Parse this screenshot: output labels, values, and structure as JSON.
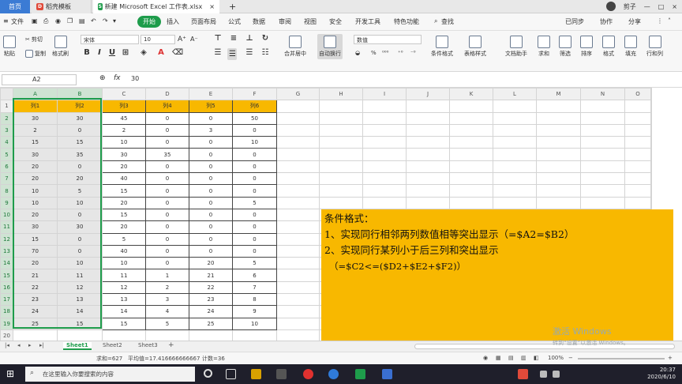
{
  "tabs": {
    "home": "首页",
    "t1": "稻壳模板",
    "t2": "新建 Microsoft Excel 工作表.xlsx",
    "add": "+"
  },
  "titlebar": {
    "user": "剪子"
  },
  "menu": [
    "文件",
    "开始",
    "插入",
    "页面布局",
    "公式",
    "数据",
    "审阅",
    "视图",
    "安全",
    "开发工具",
    "特色功能",
    "查找"
  ],
  "menu_right": [
    "已同步",
    "协作",
    "分享"
  ],
  "ribbon": {
    "paste": "粘贴",
    "cut": "剪切",
    "copy": "复制",
    "painter": "格式刷",
    "font": "宋体",
    "size": "10",
    "merge": "合并居中",
    "wrap": "自动换行",
    "numfmt": "数值",
    "cond": "条件格式",
    "tablestyle": "表格样式",
    "docassist": "文档助手",
    "sum": "求和",
    "filter": "筛选",
    "sort": "排序",
    "format": "格式",
    "fill": "填充",
    "rowcol": "行和列"
  },
  "formula": {
    "cell": "A2",
    "fx": "fx",
    "value": "30"
  },
  "columns": [
    "A",
    "B",
    "C",
    "D",
    "E",
    "F",
    "G",
    "H",
    "I",
    "J",
    "K",
    "L",
    "M",
    "N",
    "O"
  ],
  "rows": [
    "1",
    "2",
    "3",
    "4",
    "5",
    "6",
    "7",
    "8",
    "9",
    "10",
    "11",
    "12",
    "13",
    "14",
    "15",
    "16",
    "17",
    "18",
    "19",
    "20"
  ],
  "headers": [
    "列1",
    "列2",
    "列3",
    "列4",
    "列5",
    "列6"
  ],
  "data": [
    [
      "30",
      "30",
      "45",
      "0",
      "0",
      "50"
    ],
    [
      "2",
      "0",
      "2",
      "0",
      "3",
      "0"
    ],
    [
      "15",
      "15",
      "10",
      "0",
      "0",
      "10"
    ],
    [
      "30",
      "35",
      "30",
      "35",
      "0",
      "0"
    ],
    [
      "20",
      "0",
      "20",
      "0",
      "0",
      "0"
    ],
    [
      "20",
      "20",
      "40",
      "0",
      "0",
      "0"
    ],
    [
      "10",
      "5",
      "15",
      "0",
      "0",
      "0"
    ],
    [
      "10",
      "10",
      "20",
      "0",
      "0",
      "5"
    ],
    [
      "20",
      "0",
      "15",
      "0",
      "0",
      "0"
    ],
    [
      "30",
      "30",
      "20",
      "0",
      "0",
      "0"
    ],
    [
      "15",
      "0",
      "5",
      "0",
      "0",
      "0"
    ],
    [
      "70",
      "0",
      "40",
      "0",
      "0",
      "0"
    ],
    [
      "20",
      "10",
      "10",
      "0",
      "20",
      "5"
    ],
    [
      "21",
      "11",
      "11",
      "1",
      "21",
      "6"
    ],
    [
      "22",
      "12",
      "12",
      "2",
      "22",
      "7"
    ],
    [
      "23",
      "13",
      "13",
      "3",
      "23",
      "8"
    ],
    [
      "24",
      "14",
      "14",
      "4",
      "24",
      "9"
    ],
    [
      "25",
      "15",
      "15",
      "5",
      "25",
      "10"
    ]
  ],
  "note": {
    "l1": "条件格式：",
    "l2": "1、实现同行相邻两列数值相等突出显示（=$A2=$B2）",
    "l3": "2、实现同行某列小于后三列和突出显示",
    "l4": "（=$C2<=($D2+$E2+$F2)）"
  },
  "sheets": [
    "Sheet1",
    "Sheet2",
    "Sheet3"
  ],
  "status": {
    "sum": "求和=627",
    "avg": "平均值=17.416666666667",
    "count": "计数=36",
    "zoom": "100%"
  },
  "watermark": {
    "l1": "激活 Windows",
    "l2": "转到“设置”以激活 Windows。"
  },
  "taskbar": {
    "search": "在这里输入你要搜索的内容",
    "time": "20:37",
    "date": "2020/6/10"
  },
  "colors": {
    "accent": "#1e9c4b",
    "header_fill": "#f8b800",
    "home_tab": "#3b7bd4"
  }
}
